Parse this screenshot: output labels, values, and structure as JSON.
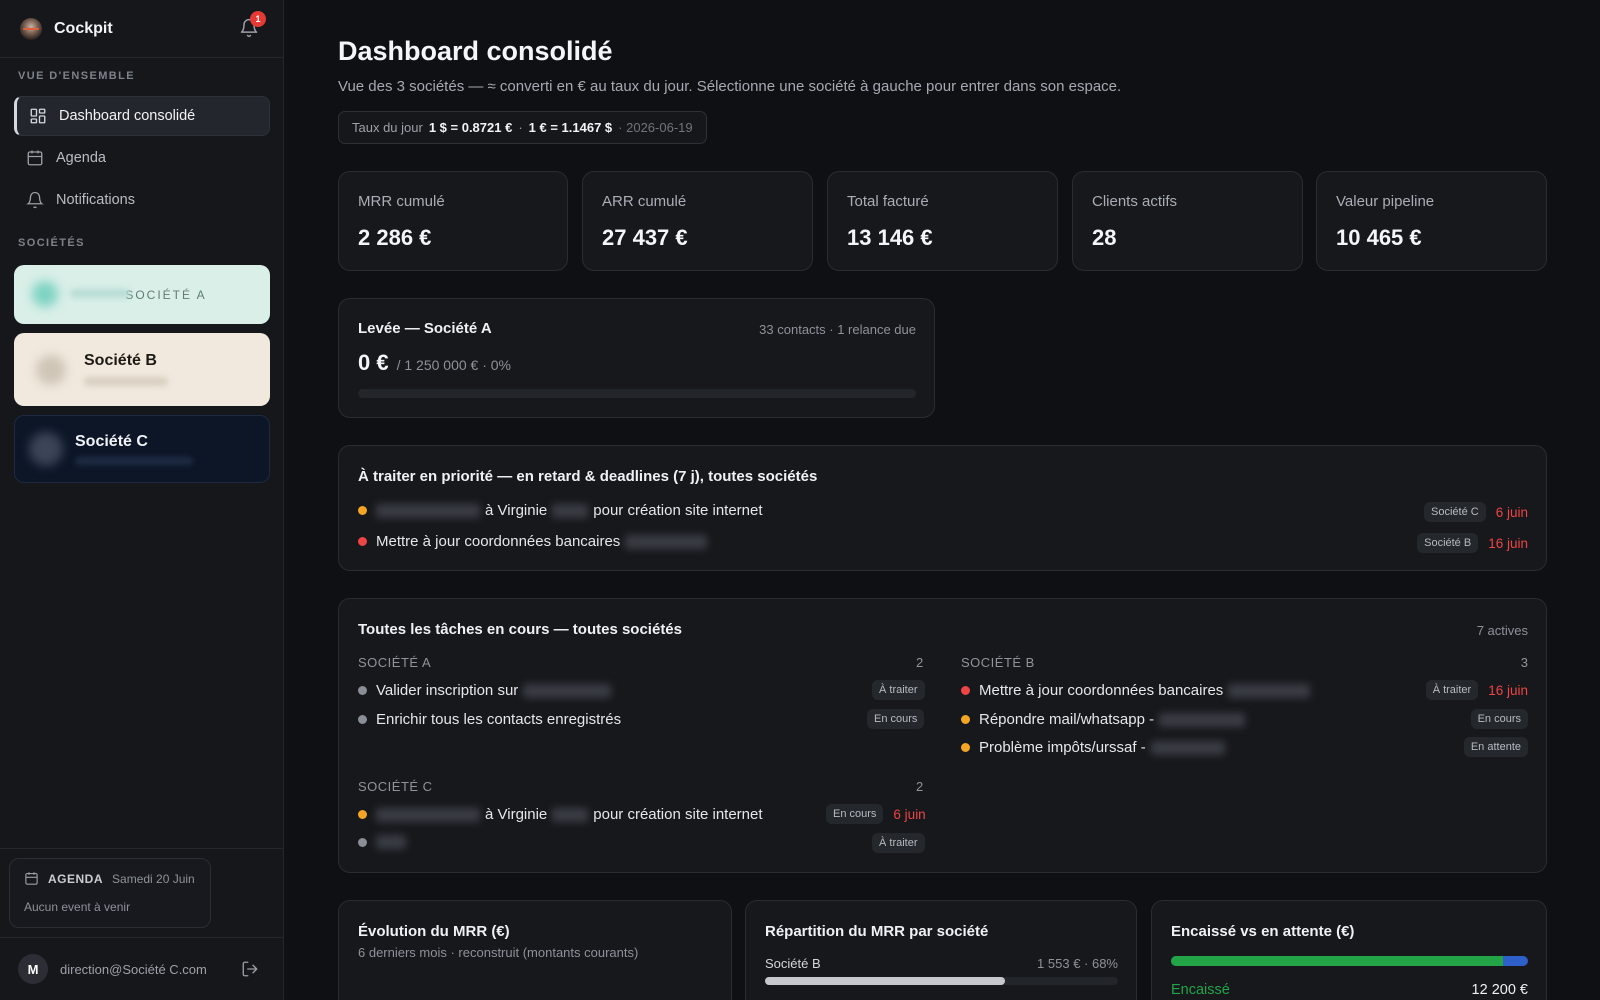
{
  "app": {
    "name": "Cockpit",
    "notification_count": "1"
  },
  "sidebar": {
    "overview_heading": "VUE D'ENSEMBLE",
    "nav": [
      {
        "label": "Dashboard consolidé",
        "icon": "dashboard-icon",
        "active": true
      },
      {
        "label": "Agenda",
        "icon": "calendar-icon"
      },
      {
        "label": "Notifications",
        "icon": "bell-icon"
      }
    ],
    "companies_heading": "SOCIÉTÉS",
    "companies": [
      {
        "name": "SOCIÉTÉ A",
        "bg": "#d9efe8"
      },
      {
        "name": "Société B",
        "bg": "#f1e9dd"
      },
      {
        "name": "Société C",
        "bg": "#0c1627"
      }
    ],
    "agenda": {
      "label": "AGENDA",
      "date": "Samedi 20 Juin",
      "empty": "Aucun event à venir"
    },
    "user": {
      "initial": "M",
      "email": "direction@Société C.com"
    }
  },
  "header": {
    "title": "Dashboard consolidé",
    "subtitle": "Vue des 3 sociétés — ≈ converti en € au taux du jour. Sélectionne une société à gauche pour entrer dans son espace.",
    "rate": {
      "label": "Taux du jour",
      "usd_eur": "1 $ = 0.8721 €",
      "sep": "·",
      "eur_usd": "1 € = 1.1467 $",
      "date": "· 2026-06-19"
    }
  },
  "kpis": [
    {
      "label": "MRR cumulé",
      "value": "2 286 €"
    },
    {
      "label": "ARR cumulé",
      "value": "27 437 €"
    },
    {
      "label": "Total facturé",
      "value": "13 146 €"
    },
    {
      "label": "Clients actifs",
      "value": "28"
    },
    {
      "label": "Valeur pipeline",
      "value": "10 465 €"
    }
  ],
  "fundraise": {
    "title": "Levée — Société A",
    "meta": "33 contacts · 1 relance due",
    "raised": "0 €",
    "goal": "/ 1 250 000 € · 0%",
    "progress": 0
  },
  "priority": {
    "title": "À traiter en priorité — en retard & deadlines (7 j), toutes sociétés",
    "items": [
      {
        "pre": "",
        "text_a": "à Virginie",
        "text_b": "pour création site internet",
        "company": "Société C",
        "date": "6 juin",
        "color": "#f5a524"
      },
      {
        "pre": "",
        "text_a": "Mettre à jour coordonnées bancaires",
        "text_b": "",
        "company": "Société B",
        "date": "16 juin",
        "color": "#ef4444"
      }
    ]
  },
  "tasks": {
    "title": "Toutes les tâches en cours — toutes sociétés",
    "count": "7 actives",
    "groups": {
      "a": {
        "name": "SOCIÉTÉ A",
        "count": "2",
        "items": [
          {
            "text": "Valider inscription sur",
            "status": "À traiter"
          },
          {
            "text": "Enrichir tous les contacts enregistrés",
            "status": "En cours"
          }
        ]
      },
      "b": {
        "name": "SOCIÉTÉ B",
        "count": "3",
        "items": [
          {
            "text": "Mettre à jour coordonnées bancaires",
            "status": "À traiter",
            "date": "16 juin"
          },
          {
            "text": "Répondre mail/whatsapp -",
            "status": "En cours"
          },
          {
            "text": "Problème impôts/urssaf -",
            "status": "En attente"
          }
        ]
      },
      "c": {
        "name": "SOCIÉTÉ C",
        "count": "2",
        "items": [
          {
            "text_a": "à Virginie",
            "text_b": "pour création site internet",
            "status": "En cours",
            "date": "6 juin"
          },
          {
            "text": "",
            "status": "À traiter"
          }
        ]
      }
    }
  },
  "bottom": {
    "mrr": {
      "title": "Évolution du MRR (€)",
      "sub": "6 derniers mois · reconstruit (montants courants)"
    },
    "split": {
      "title": "Répartition du MRR par société",
      "company": "Société B",
      "value": "1 553 € · 68%",
      "share": 0.68
    },
    "cash": {
      "title": "Encaissé vs en attente (€)",
      "label": "Encaissé",
      "value": "12 200 €",
      "paid_share": 0.93
    }
  },
  "colors": {
    "accent_green": "#22a447",
    "accent_blue": "#2f5fc9",
    "danger": "#ef4444",
    "warning": "#f5a524"
  }
}
